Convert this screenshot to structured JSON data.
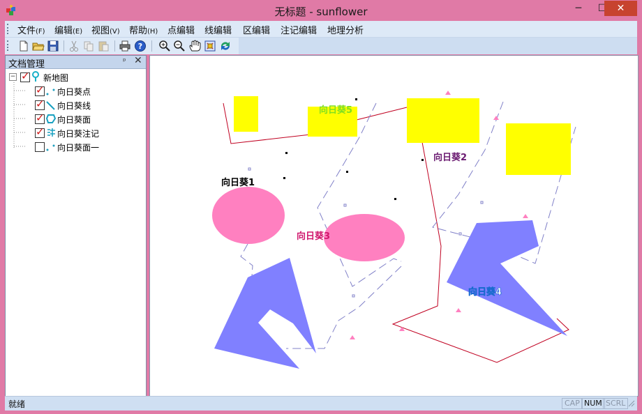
{
  "window": {
    "title": "无标题 - sunflower",
    "min_glyph": "─",
    "max_glyph": "☐",
    "close_glyph": "✕"
  },
  "menu": [
    {
      "label": "文件",
      "accel": "(F)"
    },
    {
      "label": "编辑",
      "accel": "(E)"
    },
    {
      "label": "视图",
      "accel": "(V)"
    },
    {
      "label": "帮助",
      "accel": "(H)"
    },
    {
      "label": "点编辑",
      "accel": ""
    },
    {
      "label": "线编辑",
      "accel": ""
    },
    {
      "label": "区编辑",
      "accel": ""
    },
    {
      "label": "注记编辑",
      "accel": ""
    },
    {
      "label": "地理分析",
      "accel": ""
    }
  ],
  "toolbar": {
    "icons": [
      "new-file-icon",
      "open-folder-icon",
      "save-icon",
      "cut-icon",
      "copy-icon",
      "paste-icon",
      "print-icon",
      "help-icon",
      "zoom-in-icon",
      "zoom-out-icon",
      "pan-hand-icon",
      "full-extent-icon",
      "refresh-icon"
    ]
  },
  "panel": {
    "title": "文档管理",
    "pin_glyph": "ᵖ",
    "close_glyph": "✕",
    "root": {
      "label": "新地图",
      "checked": true,
      "expander": "−"
    },
    "layers": [
      {
        "label": "向日葵点",
        "checked": true,
        "icon": "point-layer-icon"
      },
      {
        "label": "向日葵线",
        "checked": true,
        "icon": "line-layer-icon"
      },
      {
        "label": "向日葵面",
        "checked": true,
        "icon": "polygon-layer-icon"
      },
      {
        "label": "向日葵注记",
        "checked": true,
        "icon": "annotation-layer-icon"
      },
      {
        "label": "向日葵面一",
        "checked": false,
        "icon": "point-layer-icon"
      }
    ]
  },
  "map": {
    "annotations": [
      {
        "text": "向日葵5",
        "color": "#80e020"
      },
      {
        "text": "向日葵2",
        "color": "#6a1a70"
      },
      {
        "text": "向日葵1",
        "color": "#000000"
      },
      {
        "text": "向日葵3",
        "color": "#d0186e"
      },
      {
        "text": "向日葵4",
        "color": "#ffffff"
      }
    ],
    "colors": {
      "rect": "#ffff00",
      "ellipse": "#ff80c0",
      "polygon": "#8080ff",
      "line_red": "#c00020",
      "line_dash": "#8080c0",
      "triangle": "#ff80c0"
    }
  },
  "status": {
    "text": "就绪",
    "indicators": [
      {
        "label": "CAP",
        "on": false
      },
      {
        "label": "NUM",
        "on": true
      },
      {
        "label": "SCRL",
        "on": false
      }
    ]
  }
}
